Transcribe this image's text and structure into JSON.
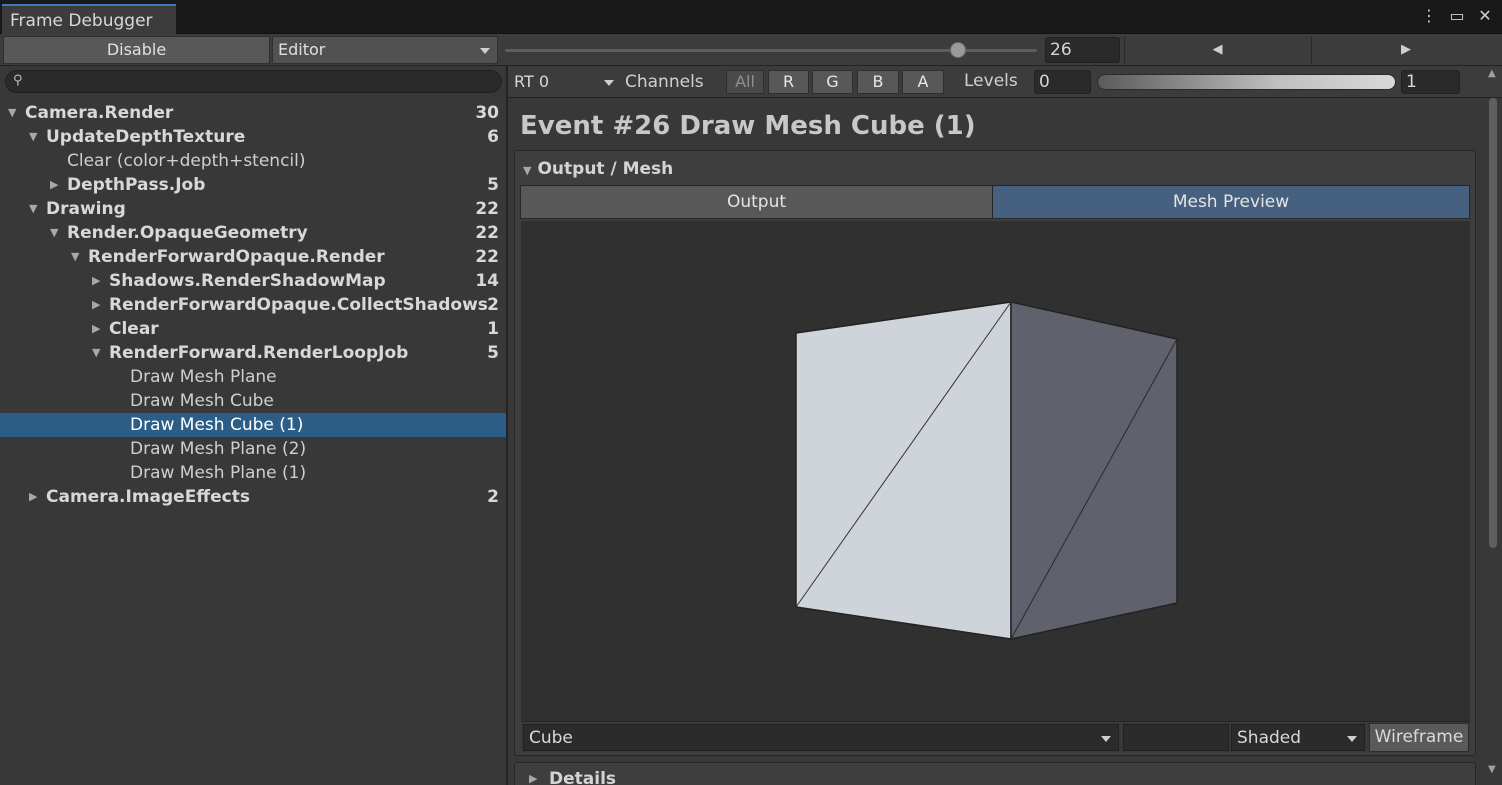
{
  "window": {
    "tab_title": "Frame Debugger",
    "icons": [
      "more-icon",
      "maximize-icon",
      "close-icon"
    ]
  },
  "toolbar": {
    "disable_label": "Disable",
    "target_dropdown": "Editor",
    "event_slider_value": 26,
    "event_number": "26"
  },
  "tree": {
    "search_placeholder": "",
    "rows": [
      {
        "label": "Camera.Render",
        "count": "30",
        "depth": 0,
        "expanded": true,
        "bold": true
      },
      {
        "label": "UpdateDepthTexture",
        "count": "6",
        "depth": 1,
        "expanded": true,
        "bold": true
      },
      {
        "label": "Clear (color+depth+stencil)",
        "count": "",
        "depth": 2,
        "leaf": true
      },
      {
        "label": "DepthPass.Job",
        "count": "5",
        "depth": 2,
        "expanded": false,
        "bold": true
      },
      {
        "label": "Drawing",
        "count": "22",
        "depth": 1,
        "expanded": true,
        "bold": true
      },
      {
        "label": "Render.OpaqueGeometry",
        "count": "22",
        "depth": 2,
        "expanded": true,
        "bold": true
      },
      {
        "label": "RenderForwardOpaque.Render",
        "count": "22",
        "depth": 3,
        "expanded": true,
        "bold": true
      },
      {
        "label": "Shadows.RenderShadowMap",
        "count": "14",
        "depth": 4,
        "expanded": false,
        "bold": true
      },
      {
        "label": "RenderForwardOpaque.CollectShadows",
        "count": "2",
        "depth": 4,
        "expanded": false,
        "bold": true
      },
      {
        "label": "Clear",
        "count": "1",
        "depth": 4,
        "expanded": false,
        "bold": true
      },
      {
        "label": "RenderForward.RenderLoopJob",
        "count": "5",
        "depth": 4,
        "expanded": true,
        "bold": true
      },
      {
        "label": "Draw Mesh Plane",
        "count": "",
        "depth": 5,
        "leaf": true
      },
      {
        "label": "Draw Mesh Cube",
        "count": "",
        "depth": 5,
        "leaf": true
      },
      {
        "label": "Draw Mesh Cube (1)",
        "count": "",
        "depth": 5,
        "leaf": true,
        "selected": true
      },
      {
        "label": "Draw Mesh Plane (2)",
        "count": "",
        "depth": 5,
        "leaf": true
      },
      {
        "label": "Draw Mesh Plane (1)",
        "count": "",
        "depth": 5,
        "leaf": true
      },
      {
        "label": "Camera.ImageEffects",
        "count": "2",
        "depth": 1,
        "expanded": false,
        "bold": true
      }
    ]
  },
  "render_bar": {
    "rt_dropdown": "RT 0",
    "channels_label": "Channels",
    "channels": [
      "All",
      "R",
      "G",
      "B",
      "A"
    ],
    "levels_label": "Levels",
    "levels_min": "0",
    "levels_max": "1"
  },
  "event": {
    "title": "Event #26 Draw Mesh Cube (1)"
  },
  "output_mesh": {
    "section_label": "Output / Mesh",
    "tab_output": "Output",
    "tab_preview": "Mesh Preview",
    "active_tab": "Mesh Preview",
    "mesh_dropdown": "Cube",
    "shading_dropdown": "Shaded",
    "wireframe_label": "Wireframe"
  },
  "details": {
    "label": "Details"
  },
  "colors": {
    "selection": "#2c5d87",
    "active_tab": "#46607f",
    "accent": "#3a79bb"
  }
}
